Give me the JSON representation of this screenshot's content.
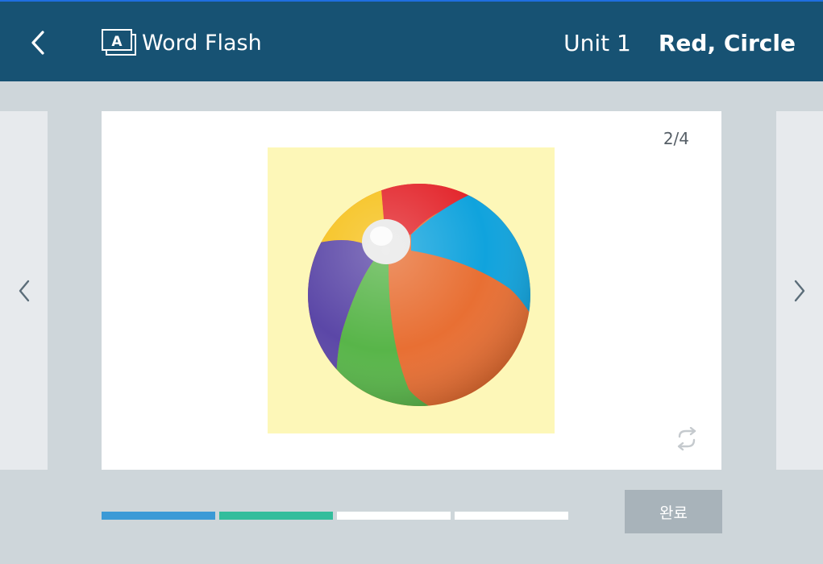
{
  "header": {
    "title": "Word Flash",
    "unit_label": "Unit 1",
    "unit_topic": "Red, Circle",
    "back_icon": "chevron-left-icon",
    "app_icon": "flashcard-a-icon"
  },
  "card": {
    "page_counter": "2/4",
    "current_page": 2,
    "total_pages": 4,
    "image": "beach-ball",
    "image_background": "#fdf7b8",
    "flip_icon": "flip-rotate-icon"
  },
  "navigation": {
    "prev_icon": "chevron-left-icon",
    "next_icon": "chevron-right-icon"
  },
  "progress": {
    "segments": [
      {
        "state": "done",
        "color": "#3c9ad6"
      },
      {
        "state": "current",
        "color": "#33bd9c"
      },
      {
        "state": "pending",
        "color": "#ffffff"
      },
      {
        "state": "pending",
        "color": "#ffffff"
      }
    ]
  },
  "actions": {
    "done_label": "완료"
  },
  "colors": {
    "header_bg": "#175273",
    "page_bg": "#ced6da",
    "side_panel_bg": "#e7eaed",
    "done_button_bg": "#a8b3ba"
  }
}
